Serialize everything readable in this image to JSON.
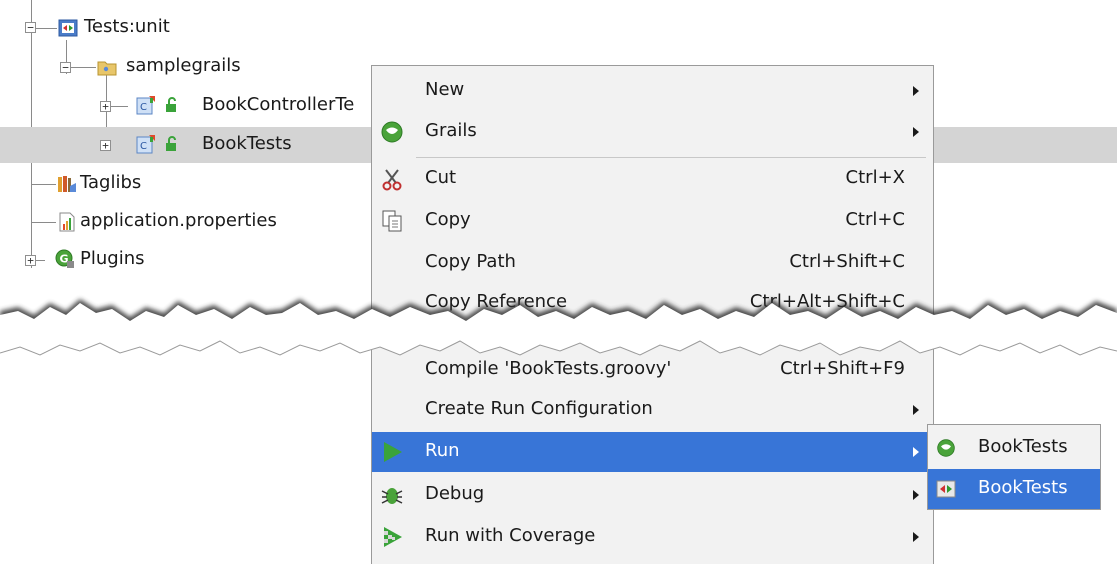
{
  "tree": {
    "items": [
      {
        "label": "Tests:unit",
        "expander": "−"
      },
      {
        "label": "samplegrails",
        "expander": "−"
      },
      {
        "label": "BookControllerTe",
        "expander": "+"
      },
      {
        "label": "BookTests",
        "expander": "+",
        "selected": true
      },
      {
        "label": "Taglibs"
      },
      {
        "label": "application.properties"
      },
      {
        "label": "Plugins",
        "expander": "+"
      }
    ]
  },
  "context_menu": {
    "items": [
      {
        "label": "New",
        "has_submenu": true
      },
      {
        "label": "Grails",
        "icon": "grails-icon",
        "has_submenu": true
      },
      {
        "label": "Cut",
        "shortcut": "Ctrl+X",
        "icon": "scissors-icon"
      },
      {
        "label": "Copy",
        "shortcut": "Ctrl+C",
        "icon": "copy-icon"
      },
      {
        "label": "Copy Path",
        "shortcut": "Ctrl+Shift+C"
      },
      {
        "label": "Copy Reference",
        "shortcut": "Ctrl+Alt+Shift+C"
      },
      {
        "label": "Compile 'BookTests.groovy'",
        "shortcut": "Ctrl+Shift+F9"
      },
      {
        "label": "Create Run Configuration",
        "has_submenu": true
      },
      {
        "label": "Run",
        "icon": "run-icon",
        "has_submenu": true,
        "active": true
      },
      {
        "label": "Debug",
        "icon": "debug-icon",
        "has_submenu": true
      },
      {
        "label": "Run with Coverage",
        "icon": "coverage-icon",
        "has_submenu": true
      }
    ]
  },
  "run_submenu": {
    "items": [
      {
        "label": "BookTests",
        "icon": "grails-icon"
      },
      {
        "label": "BookTests",
        "icon": "junit-icon",
        "active": true
      }
    ]
  },
  "colors": {
    "highlight": "#3875d7",
    "selection": "#d4d4d4",
    "menu_bg": "#f2f2f2",
    "run_green": "#3aa33a"
  }
}
